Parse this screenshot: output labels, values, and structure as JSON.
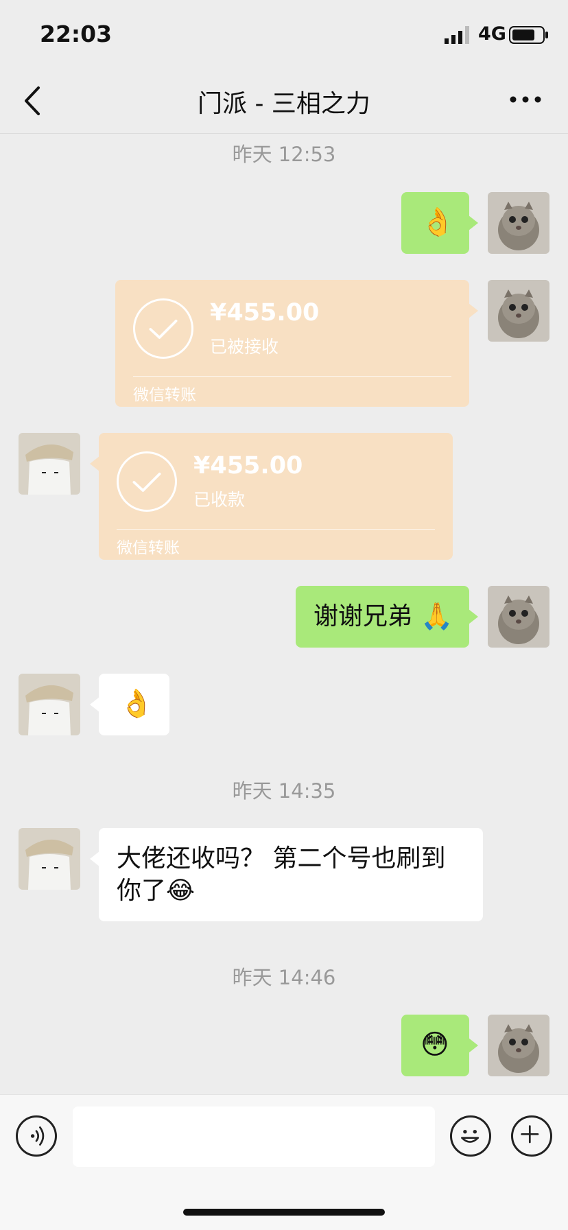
{
  "status_bar": {
    "time": "22:03",
    "network": "4G"
  },
  "nav": {
    "title": "门派 - 三相之力"
  },
  "messages": {
    "ts1": "昨天 12:53",
    "m1_emoji": "👌",
    "transfer1": {
      "amount": "¥455.00",
      "status": "已被接收",
      "label": "微信转账"
    },
    "transfer2": {
      "amount": "¥455.00",
      "status": "已收款",
      "label": "微信转账"
    },
    "m4_text": "谢谢兄弟",
    "m4_emoji": "🙏",
    "m5_emoji": "👌",
    "ts2": "昨天 14:35",
    "m6_text": "大佬还收吗？ 第二个号也刷到你了",
    "m6_emoji": "😂",
    "ts3": "昨天 14:46",
    "m7_emoji": "😳"
  },
  "input": {
    "value": ""
  },
  "colors": {
    "bubble_green": "#a9e97a",
    "transfer_bg": "#f8e0c3",
    "background": "#ededed"
  },
  "icons": [
    "signal-icon",
    "battery-icon",
    "back-icon",
    "more-icon",
    "check-icon",
    "voice-icon",
    "emoji-icon",
    "plus-icon"
  ]
}
